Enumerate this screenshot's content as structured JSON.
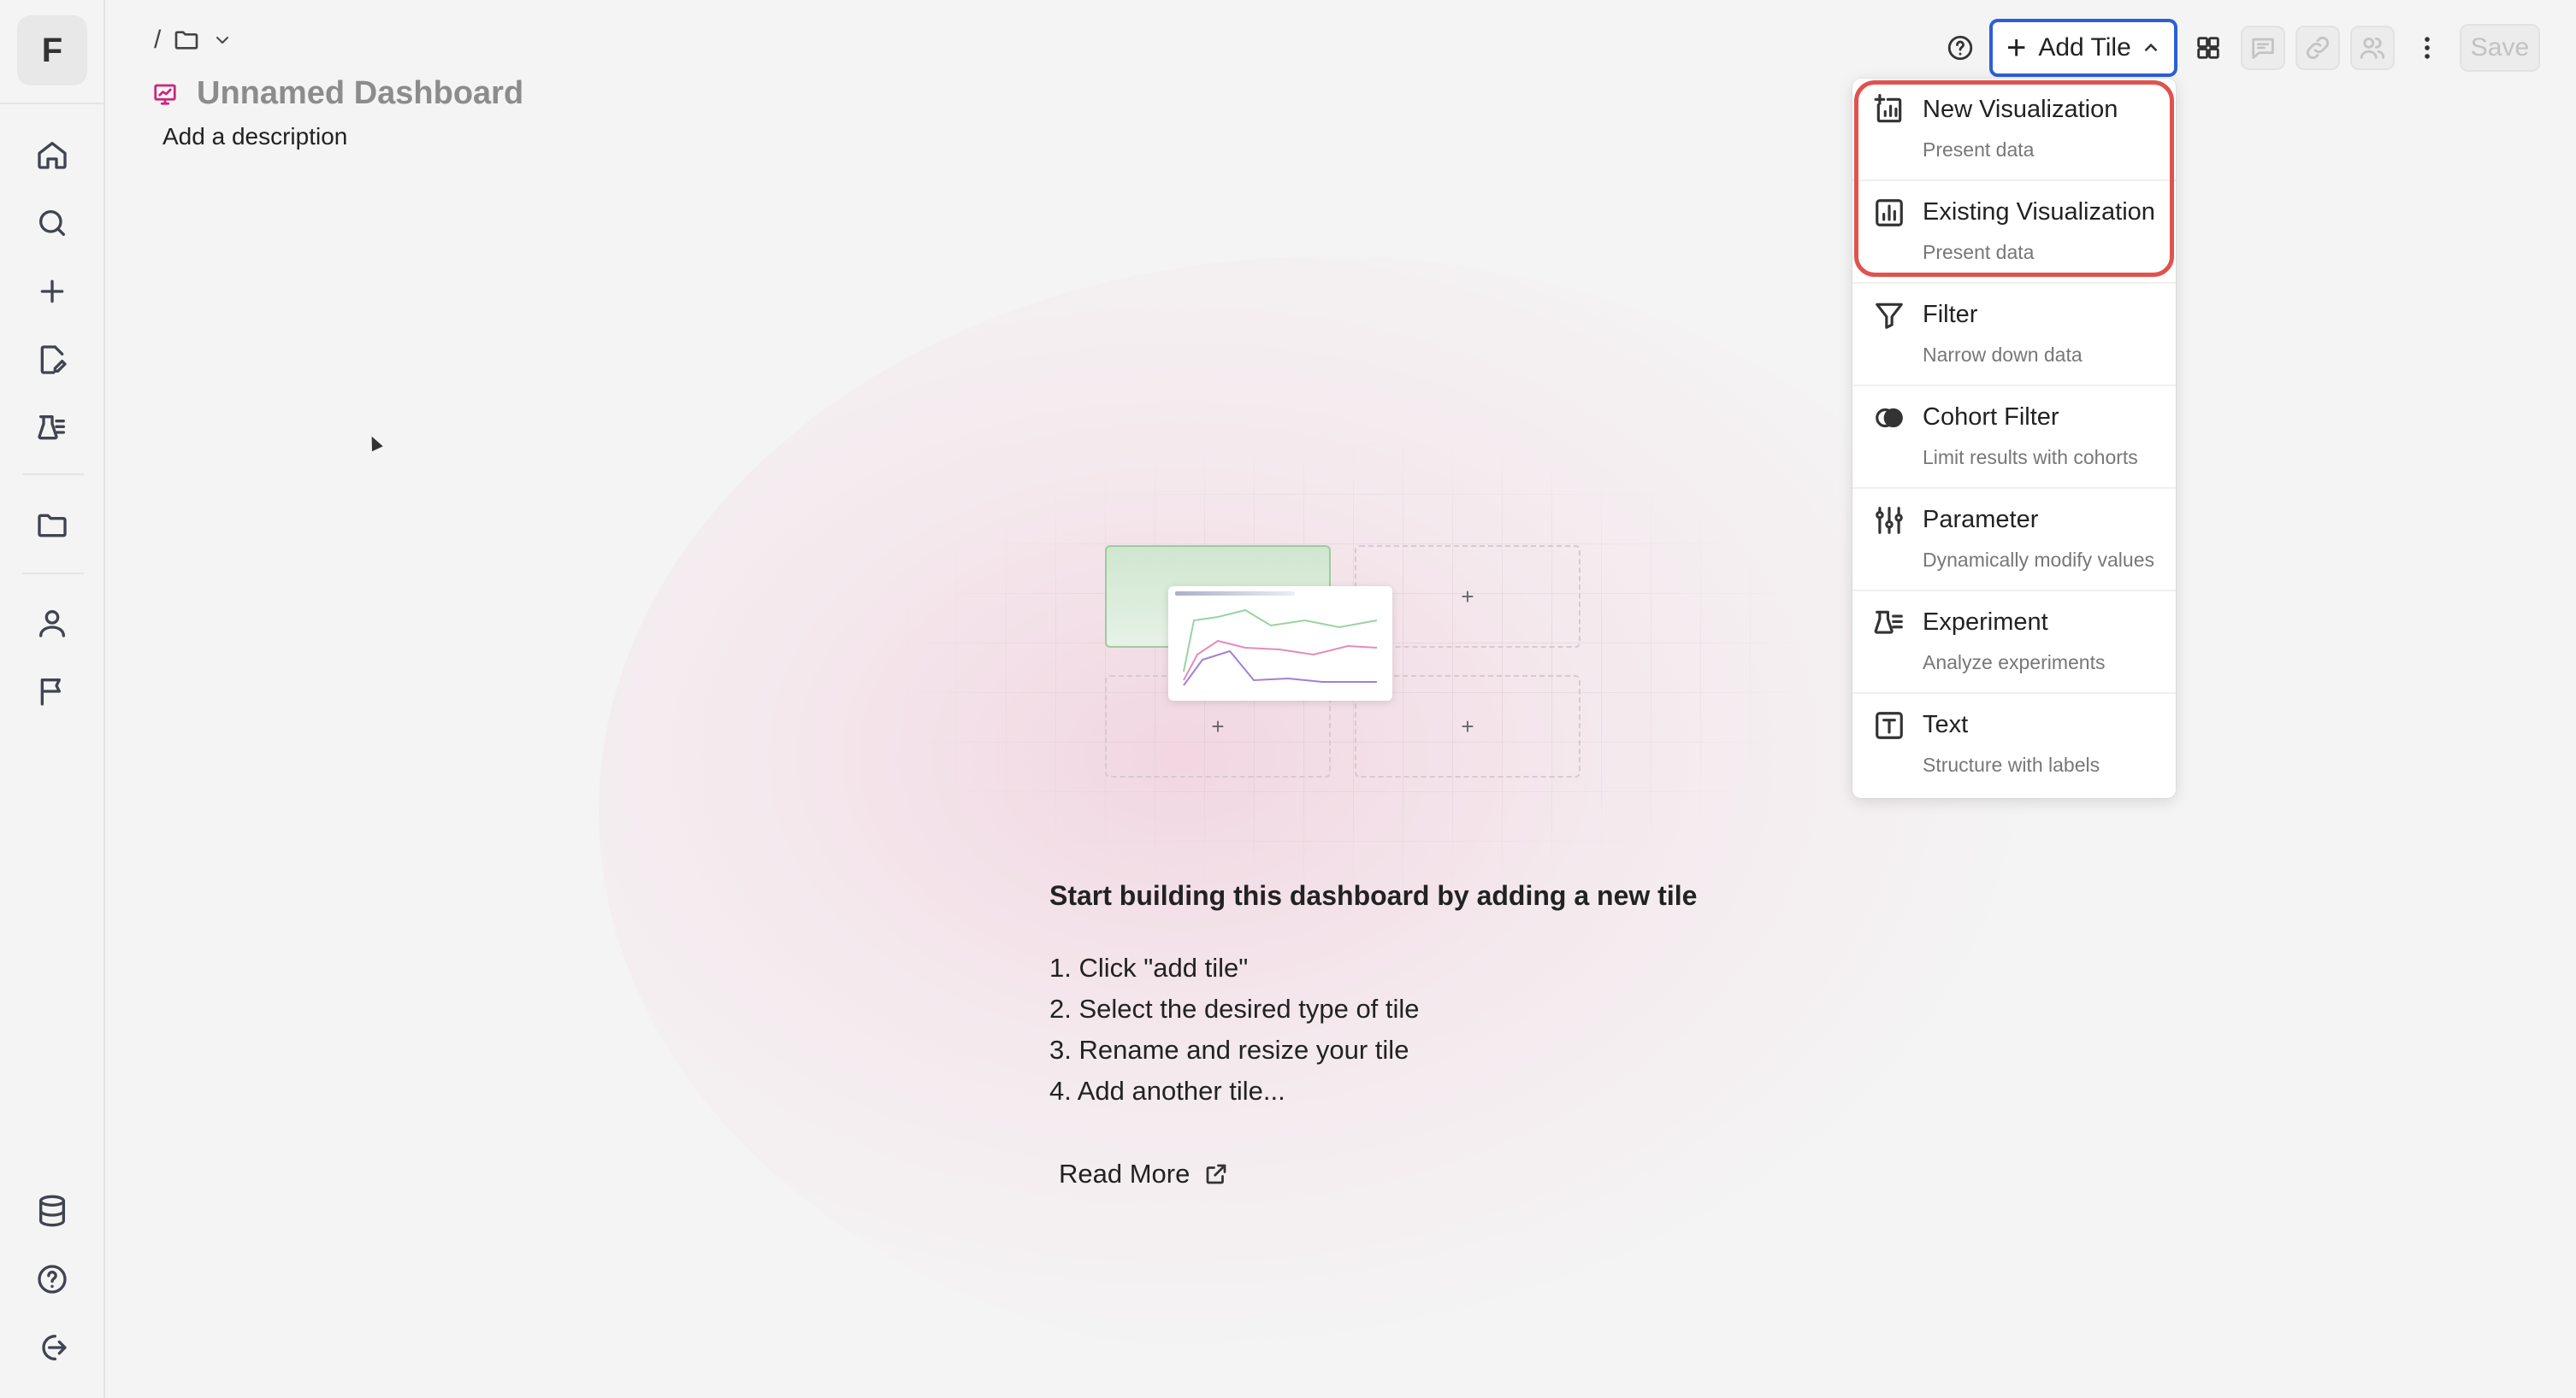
{
  "app": {
    "logo_letter": "F"
  },
  "sidebar": {
    "items": [
      {
        "name": "home-icon"
      },
      {
        "name": "search-icon"
      },
      {
        "name": "plus-icon"
      },
      {
        "name": "edit-document-icon"
      },
      {
        "name": "experiment-icon"
      },
      {
        "name": "folder-icon"
      },
      {
        "name": "user-icon"
      },
      {
        "name": "flag-icon"
      },
      {
        "name": "database-icon"
      },
      {
        "name": "help-icon"
      },
      {
        "name": "logout-icon"
      }
    ]
  },
  "breadcrumb": {
    "separator": "/"
  },
  "dashboard": {
    "title": "Unnamed Dashboard",
    "description_placeholder": "Add a description"
  },
  "toolbar": {
    "add_tile_label": "Add Tile",
    "save_label": "Save"
  },
  "add_tile_menu": {
    "items": [
      {
        "label": "New Visualization",
        "description": "Present data",
        "icon": "new-visualization-icon"
      },
      {
        "label": "Existing Visualization",
        "description": "Present data",
        "icon": "bar-chart-icon"
      },
      {
        "label": "Filter",
        "description": "Narrow down data",
        "icon": "filter-icon"
      },
      {
        "label": "Cohort Filter",
        "description": "Limit results with cohorts",
        "icon": "cohort-filter-icon"
      },
      {
        "label": "Parameter",
        "description": "Dynamically modify values",
        "icon": "sliders-icon"
      },
      {
        "label": "Experiment",
        "description": "Analyze experiments",
        "icon": "experiment-icon"
      },
      {
        "label": "Text",
        "description": "Structure with labels",
        "icon": "text-icon"
      }
    ]
  },
  "empty_state": {
    "tile_plus": "+",
    "title": "Start building this dashboard by adding a new tile",
    "steps": [
      "1. Click \"add tile\"",
      "2. Select the desired type of tile",
      "3. Rename and resize your tile",
      "4. Add another tile..."
    ],
    "read_more_label": "Read More"
  },
  "colors": {
    "accent": "#2c5fd6",
    "highlight_ring": "#e0524f",
    "dashboard_icon": "#c9287a"
  }
}
